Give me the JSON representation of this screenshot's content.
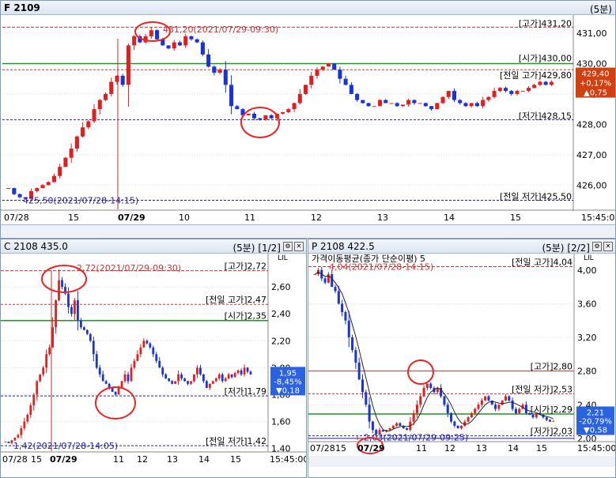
{
  "top": {
    "title": "F 2109",
    "period": "(5분)",
    "yticks": [
      "431,00",
      "430,00",
      "429,00",
      "428,00",
      "427,00",
      "426,00"
    ],
    "xticks": [
      "07/28",
      "15",
      "07/29",
      "10",
      "11",
      "12",
      "13",
      "14",
      "15",
      "15:45:00"
    ],
    "levels": {
      "high": "[고가]431,20",
      "open": "[시가]430,00",
      "prev_high": "[전일 고가]429,80",
      "low": "[저가]428,15",
      "prev_low": "[전일 저가]425,50"
    },
    "annot_high": "431,20(2021/07/29-09:30)",
    "annot_low": "425,50(2021/07/28-14:15)",
    "current": {
      "price": "429,40",
      "pct": "+0,17%",
      "chg": "▲0,75"
    },
    "colors": {
      "up": "#e02020",
      "down": "#1a33d8",
      "level_red": "#d03030",
      "level_green": "#1a9a1a",
      "level_blue": "#2020a0"
    }
  },
  "call": {
    "title": "C 2108 435.0",
    "period": "(5분)",
    "page": "[1/2]",
    "yticks": [
      "2,60",
      "2,40",
      "2,20",
      "2,00",
      "1,80",
      "1,60",
      "1,40"
    ],
    "xticks": [
      "07/28",
      "15",
      "07/29",
      "11",
      "12",
      "13",
      "14",
      "15",
      "15:45:00"
    ],
    "levels": {
      "high": "[고가]2,72",
      "prev_high": "[전일 고가]2,47",
      "open": "[시가]2,35",
      "low": "[저가]1,79",
      "prev_low": "[전일 저가]1,42"
    },
    "annot_high": "2,72(2021/07/29-09:30)",
    "annot_low": "1,42(2021/07/28-14:05)",
    "current": {
      "price": "1,95",
      "pct": "-8,45%",
      "chg": "▼0,18"
    }
  },
  "put": {
    "title": "P 2108 422.5",
    "period": "(5분)",
    "page": "[2/2]",
    "ma_label": "가격이동평균(종가 단순이평) 5",
    "yticks": [
      "4,00",
      "3,60",
      "3,20",
      "2,80",
      "2,40",
      "2,00"
    ],
    "xticks": [
      "07/28",
      "15",
      "07/29",
      "11",
      "12",
      "13",
      "14",
      "15",
      "15:45:00"
    ],
    "levels": {
      "prev_high": "[전일 고가]4,04",
      "high": "[고가]2,80",
      "prev_low": "[전일 저가]2,53",
      "open": "[시가]2,29",
      "low": "[저가]2,03"
    },
    "annot_high": "4,04(2021/07/28-14:15)",
    "annot_low": "2,03(2021/07/29-09:25)",
    "current": {
      "price": "2,21",
      "pct": "-20,79%",
      "chg": "▼0,58"
    }
  }
}
